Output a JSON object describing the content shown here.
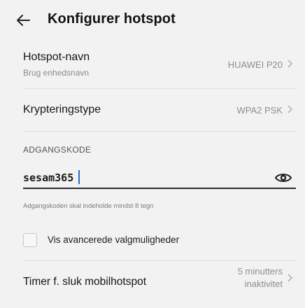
{
  "header": {
    "title": "Konfigurer hotspot",
    "back_icon": "arrow-left-icon"
  },
  "settings": {
    "hotspot_name": {
      "label": "Hotspot-navn",
      "sublabel": "Brug enhedsnavn",
      "value": "HUAWEI P20"
    },
    "encryption": {
      "label": "Krypteringstype",
      "value": "WPA2 PSK"
    }
  },
  "password_section": {
    "header": "ADGANGSKODE",
    "value": "sesam365",
    "helper": "Adgangskoden skal indeholde mindst 8 tegn",
    "visibility_icon": "eye-icon"
  },
  "advanced": {
    "label": "Vis avancerede valgmuligheder",
    "checked": false
  },
  "timer": {
    "label": "Timer f. sluk mobilhotspot",
    "value_line1": "5 minutters",
    "value_line2": "inaktivitet"
  },
  "colors": {
    "background": "#f2f2f2",
    "caret": "#1e6fd9"
  }
}
